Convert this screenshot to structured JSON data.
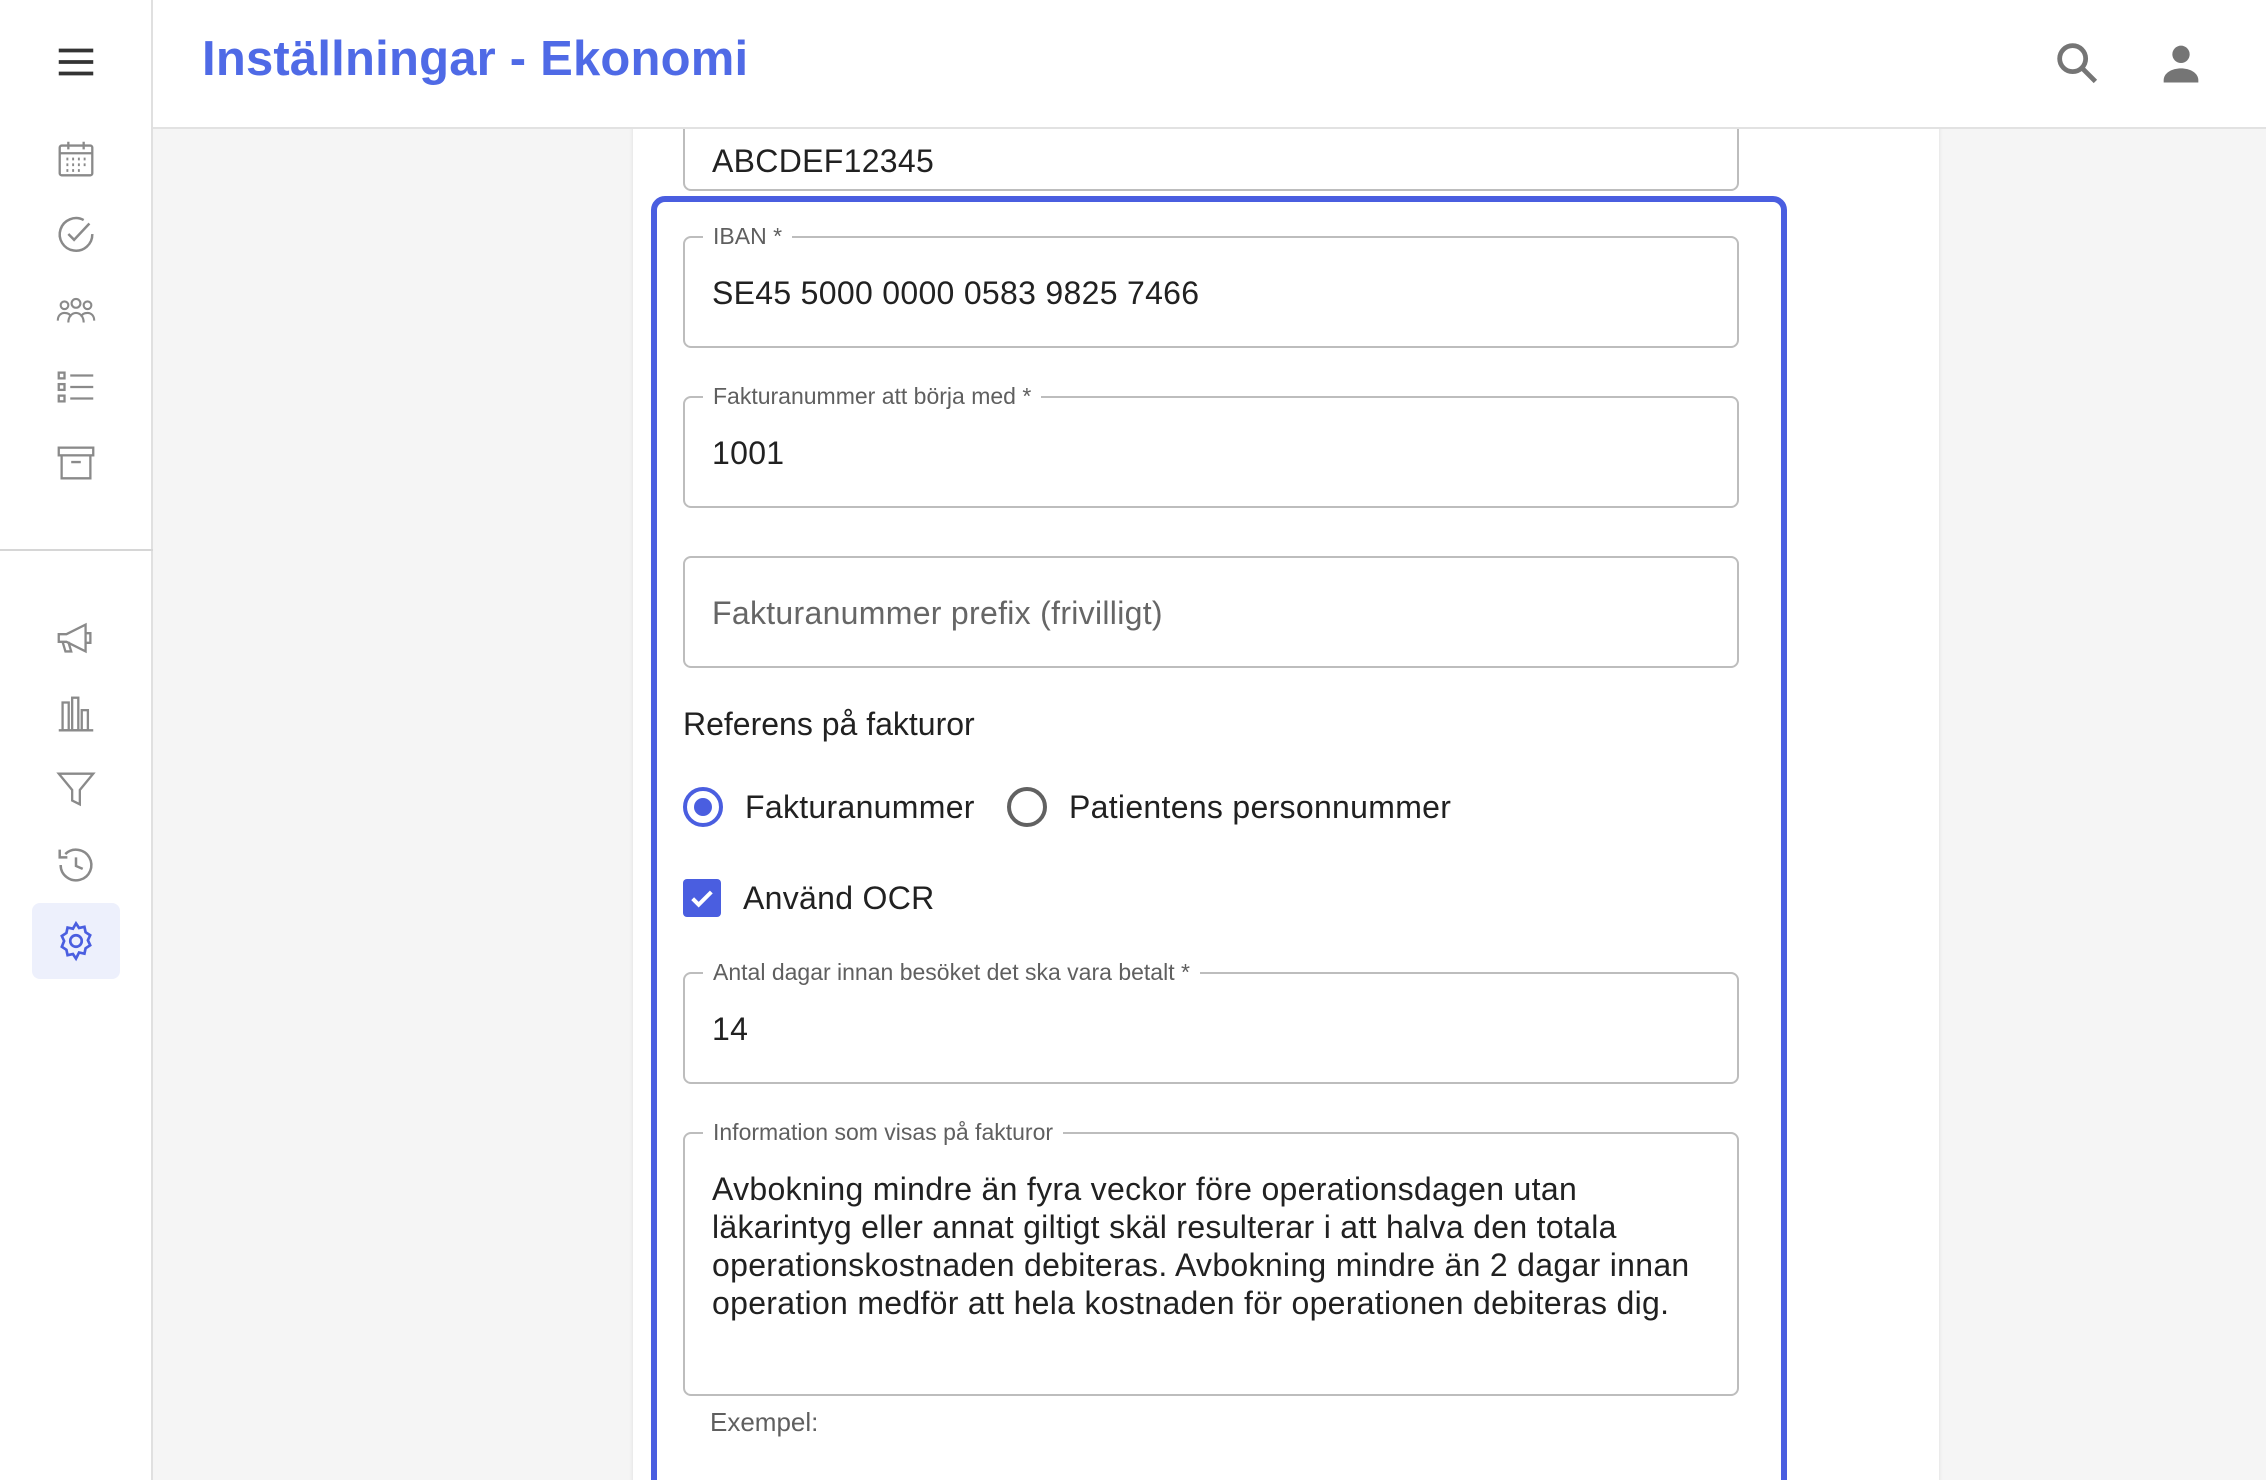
{
  "header": {
    "title": "Inställningar - Ekonomi",
    "search_icon": "search-icon",
    "account_icon": "account-icon"
  },
  "sidebar": {
    "menu_icon": "menu-icon",
    "items": [
      {
        "icon": "calendar-icon"
      },
      {
        "icon": "check-circle-icon"
      },
      {
        "icon": "group-icon"
      },
      {
        "icon": "list-icon"
      },
      {
        "icon": "archive-icon"
      },
      {
        "icon": "megaphone-icon"
      },
      {
        "icon": "bar-chart-icon"
      },
      {
        "icon": "filter-icon"
      },
      {
        "icon": "history-icon"
      },
      {
        "icon": "settings-icon",
        "active": true
      }
    ]
  },
  "form": {
    "top_field": {
      "value": "ABCDEF12345"
    },
    "iban": {
      "label": "IBAN *",
      "value": "SE45 5000 0000 0583 9825 7466"
    },
    "invoice_start": {
      "label": "Fakturanummer att börja med *",
      "value": "1001"
    },
    "invoice_prefix": {
      "placeholder": "Fakturanummer prefix (frivilligt)"
    },
    "reference": {
      "heading": "Referens på fakturor",
      "options": [
        {
          "label": "Fakturanummer",
          "selected": true
        },
        {
          "label": "Patientens personnummer",
          "selected": false
        }
      ]
    },
    "use_ocr": {
      "label": "Använd OCR",
      "checked": true
    },
    "days_before": {
      "label": "Antal dagar innan besöket det ska vara betalt *",
      "value": "14"
    },
    "invoice_info": {
      "label": "Information som visas på fakturor",
      "value": "Avbokning mindre än fyra veckor före operationsdagen utan läkarintyg eller annat giltigt skäl resulterar i att halva den totala operationskostnaden debiteras. Avbokning mindre än 2 dagar innan operation medför att hela kostnaden för operationen debiteras dig."
    },
    "example_label": "Exempel:"
  },
  "colors": {
    "accent": "#4a5ee0",
    "title": "#4f6ae6",
    "icon_gray": "#9e9e9e"
  }
}
